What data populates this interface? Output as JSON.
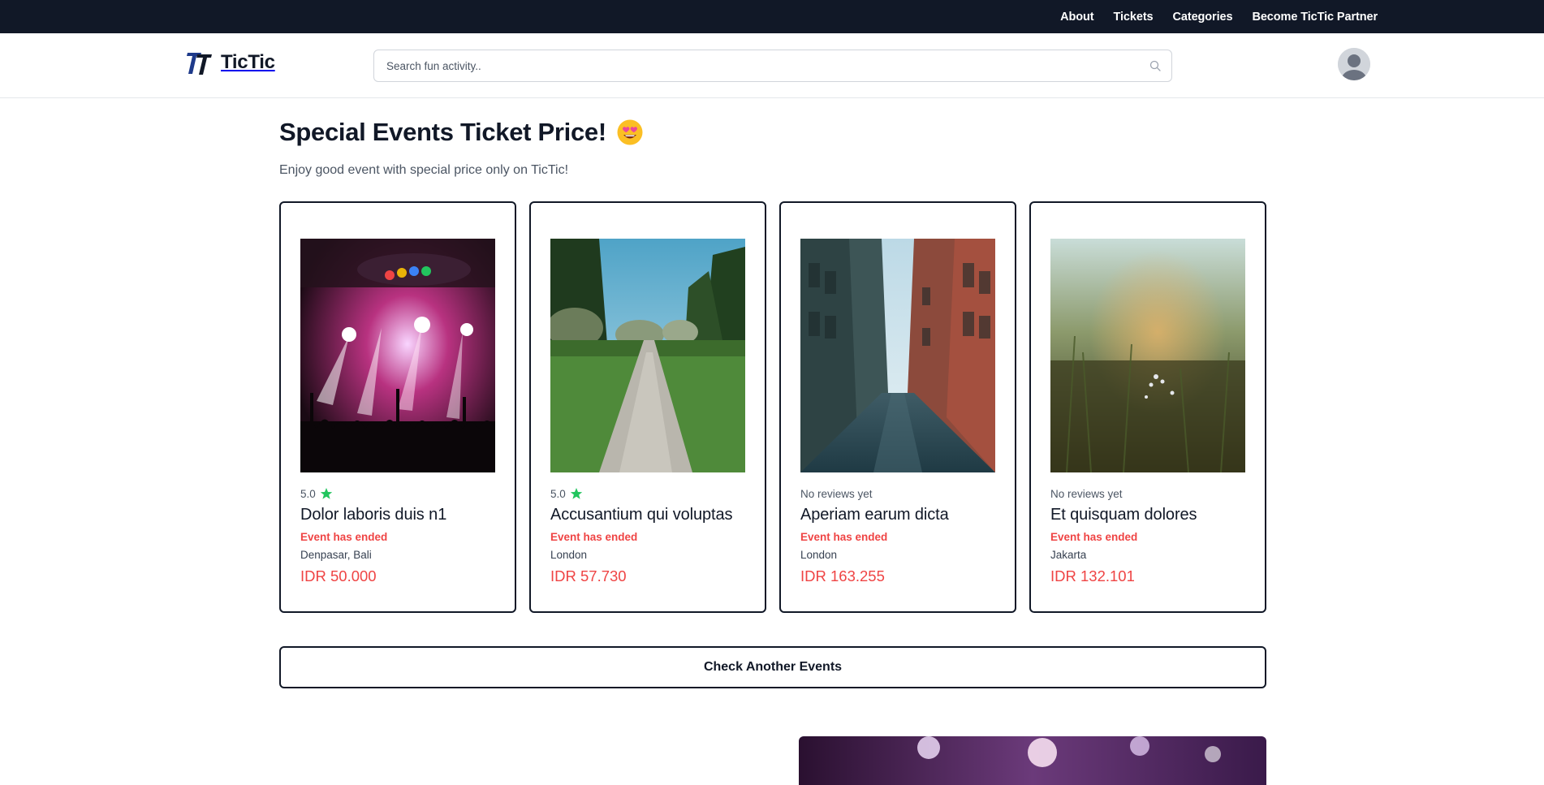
{
  "topnav": {
    "items": [
      "About",
      "Tickets",
      "Categories",
      "Become TicTic Partner"
    ]
  },
  "header": {
    "brand": "TicTic",
    "search_placeholder": "Search fun activity.."
  },
  "section": {
    "title": "Special Events Ticket Price!",
    "title_icon": "heart-eyes-emoji-icon",
    "subtitle": "Enjoy good event with special price only on TicTic!"
  },
  "events": [
    {
      "image": "concert-photo",
      "rating": "5.0",
      "has_rating": true,
      "title": "Dolor laboris duis n1",
      "status": "Event has ended",
      "location": "Denpasar, Bali",
      "price": "IDR 50.000"
    },
    {
      "image": "park-path-photo",
      "rating": "5.0",
      "has_rating": true,
      "title": "Accusantium qui voluptas",
      "status": "Event has ended",
      "location": "London",
      "price": "IDR 57.730"
    },
    {
      "image": "city-street-photo",
      "rating": "No reviews yet",
      "has_rating": false,
      "title": "Aperiam earum dicta",
      "status": "Event has ended",
      "location": "London",
      "price": "IDR 163.255"
    },
    {
      "image": "meadow-photo",
      "rating": "No reviews yet",
      "has_rating": false,
      "title": "Et quisquam dolores",
      "status": "Event has ended",
      "location": "Jakarta",
      "price": "IDR 132.101"
    }
  ],
  "cta": {
    "label": "Check Another Events"
  },
  "colors": {
    "navy": "#111827",
    "accent_red": "#ef4444",
    "star_green": "#22c55e",
    "brand_blue": "#1e3a8a"
  }
}
